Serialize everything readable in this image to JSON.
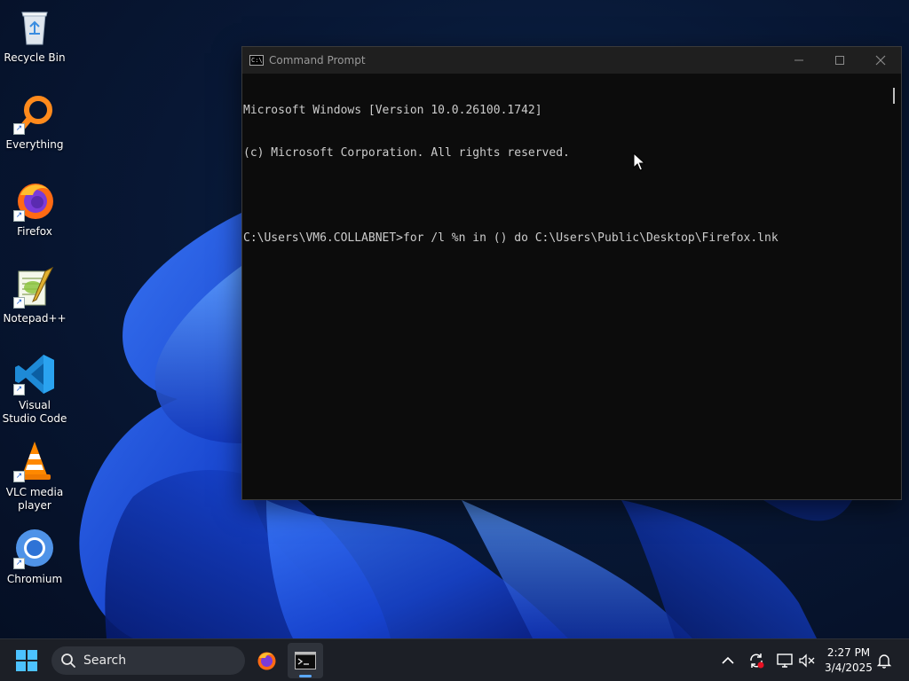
{
  "desktop_icons": [
    {
      "label": "Recycle Bin",
      "icon": "recycle-bin-icon"
    },
    {
      "label": "Everything",
      "icon": "everything-search-icon"
    },
    {
      "label": "Firefox",
      "icon": "firefox-icon"
    },
    {
      "label": "Notepad++",
      "icon": "notepad-plus-plus-icon"
    },
    {
      "label": "Visual Studio Code",
      "icon": "vscode-icon"
    },
    {
      "label": "VLC media player",
      "icon": "vlc-icon"
    },
    {
      "label": "Chromium",
      "icon": "chromium-icon"
    }
  ],
  "cmd_window": {
    "title": "Command Prompt",
    "lines": [
      "Microsoft Windows [Version 10.0.26100.1742]",
      "(c) Microsoft Corporation. All rights reserved.",
      "",
      "C:\\Users\\VM6.COLLABNET>for /l %n in () do C:\\Users\\Public\\Desktop\\Firefox.lnk"
    ]
  },
  "taskbar": {
    "search_placeholder": "Search",
    "apps": [
      "firefox-icon",
      "command-prompt-icon"
    ],
    "active_app": "command-prompt-icon",
    "tray_icons": [
      "chevron-up-icon",
      "sync-icon",
      "network-icon",
      "volume-muted-icon",
      "notification-bell-icon"
    ],
    "time": "2:27 PM",
    "date": "3/4/2025"
  },
  "colors": {
    "terminal_bg": "#0c0c0c",
    "terminal_text": "#cccccc",
    "taskbar_bg": "#1c1f26",
    "accent": "#5aa8ff"
  }
}
